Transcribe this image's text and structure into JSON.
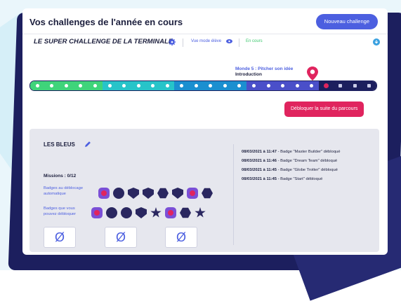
{
  "header": {
    "title": "Vos challenges de l'année en cours",
    "new_button": "Nouveau challenge"
  },
  "challenge": {
    "title": "LE SUPER CHALLENGE DE LA TERMINALE",
    "student_view": "Vue mode élève",
    "status": "En cours"
  },
  "progress": {
    "world_label": "Monde 5 : Pitcher son idée",
    "step_label": "Introduction",
    "segments_total": 24,
    "segments_completed": 20,
    "current_index": 20
  },
  "unlock_button": "Débloquer la suite du parcours",
  "team": {
    "name": "LES BLEUS",
    "missions": "Missions : 0/12",
    "auto_badges_label": "Badges au déblocage automatique",
    "unlockable_badges_label": "Badges que vous pouvez débloquer",
    "slot_symbol": "Ø",
    "log": [
      {
        "time": "08/03/2021 à 11:47",
        "text": " - Badge \"Master Builder\" débloqué"
      },
      {
        "time": "08/03/2021 à 11:46",
        "text": " - Badge \"Dream Team\" débloqué"
      },
      {
        "time": "08/03/2021 à 11:45",
        "text": " - Badge \"Globe Trotter\" débloqué"
      },
      {
        "time": "08/03/2021 à 11:45",
        "text": " - Badge \"Start\" débloqué"
      }
    ]
  },
  "colors": {
    "accent": "#4c5fe0",
    "cta": "#e0245e",
    "status_green": "#3cc86e",
    "gradient": [
      "#3fd47a",
      "#27c4c9",
      "#1b8fd0",
      "#4a4fc9",
      "#2a2aa0",
      "#1c1f5e"
    ]
  }
}
